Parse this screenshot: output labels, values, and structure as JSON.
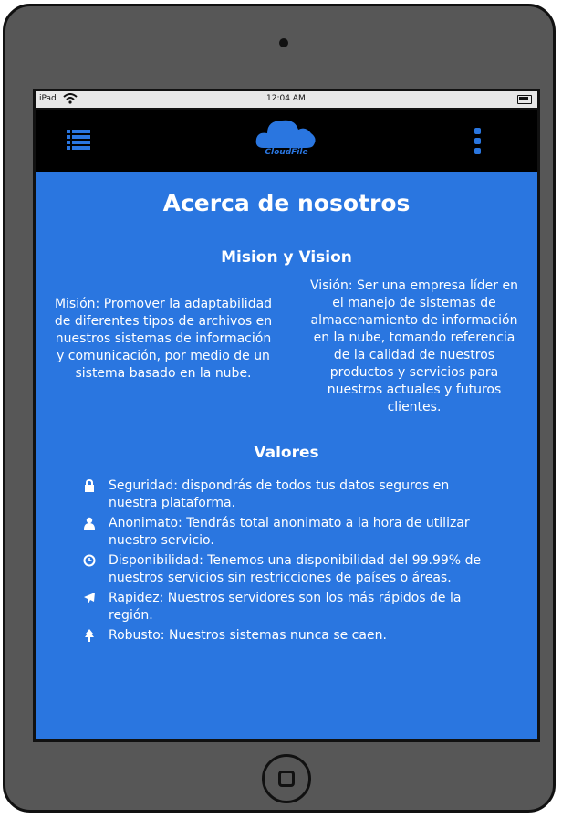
{
  "statusbar": {
    "carrier": "iPad",
    "time": "12:04 AM"
  },
  "navbar": {
    "logo_text": "CloudFile",
    "menu_icon": "list-icon",
    "more_icon": "kebab-icon"
  },
  "page": {
    "title": "Acerca de nosotros",
    "mission_vision_title": "Mision y Vision",
    "mission": "Misión: Promover la adaptabilidad de diferentes tipos de archivos en nuestros sistemas de información y comunicación, por medio de un sistema basado en la nube.",
    "vision": "Visión: Ser una empresa líder en el manejo de sistemas de almacenamiento de información en la nube, tomando referencia de la calidad de nuestros productos y servicios para nuestros actuales y futuros clientes.",
    "values_title": "Valores",
    "values": [
      {
        "icon": "lock-icon",
        "text": "Seguridad: dispondrás de todos tus datos seguros en nuestra plataforma."
      },
      {
        "icon": "user-icon",
        "text": "Anonimato: Tendrás total anonimato a la hora de utilizar nuestro servicio."
      },
      {
        "icon": "clock-icon",
        "text": "Disponibilidad: Tenemos una disponibilidad del 99.99% de nuestros servicios sin restricciones de países o áreas."
      },
      {
        "icon": "plane-icon",
        "text": "Rapidez: Nuestros servidores son los más rápidos de la región."
      },
      {
        "icon": "tree-icon",
        "text": "Robusto: Nuestros sistemas nunca se caen."
      }
    ]
  },
  "colors": {
    "primary": "#2a76e0",
    "navbar": "#000000",
    "device": "#575757",
    "statusbar": "#e8e8e8"
  }
}
